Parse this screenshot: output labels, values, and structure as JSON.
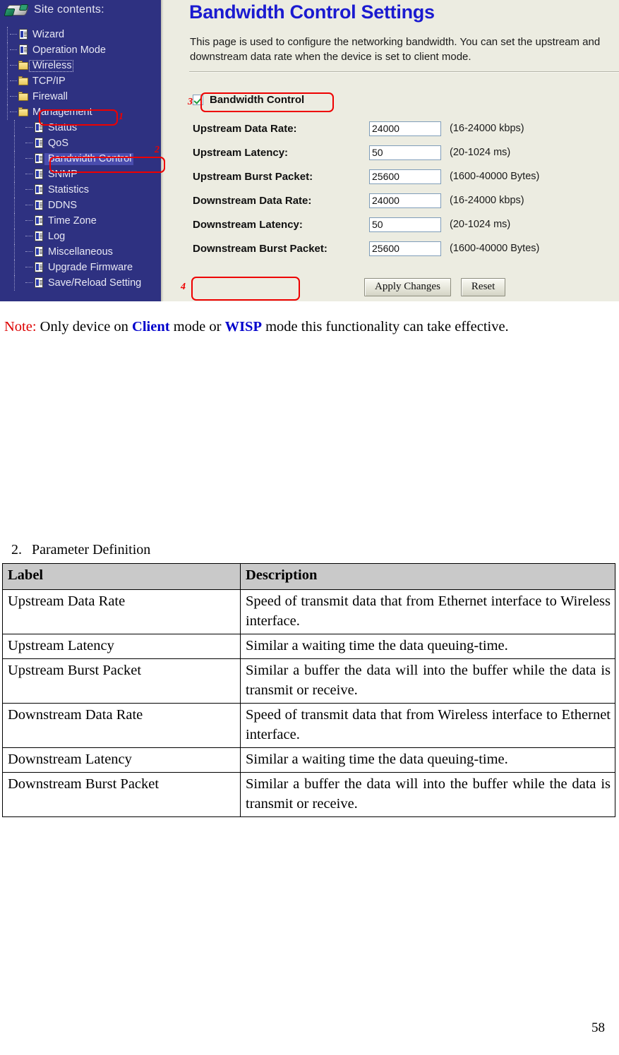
{
  "screenshot": {
    "sidebar": {
      "header_label": "Site contents:",
      "device_icon": "router-device-icon",
      "items": [
        {
          "label": "Wizard",
          "icon": "page-icon",
          "level": 1,
          "state": "normal"
        },
        {
          "label": "Operation Mode",
          "icon": "page-icon",
          "level": 1,
          "state": "normal"
        },
        {
          "label": "Wireless",
          "icon": "folder-icon",
          "level": 1,
          "state": "focused"
        },
        {
          "label": "TCP/IP",
          "icon": "folder-icon",
          "level": 1,
          "state": "normal"
        },
        {
          "label": "Firewall",
          "icon": "folder-icon",
          "level": 1,
          "state": "normal"
        },
        {
          "label": "Management",
          "icon": "folder-icon",
          "level": 1,
          "state": "annotated"
        },
        {
          "label": "Status",
          "icon": "page-icon",
          "level": 2,
          "state": "normal"
        },
        {
          "label": "QoS",
          "icon": "page-icon",
          "level": 2,
          "state": "normal"
        },
        {
          "label": "Bandwidth Control",
          "icon": "page-icon",
          "level": 2,
          "state": "selected"
        },
        {
          "label": "SNMP",
          "icon": "page-icon",
          "level": 2,
          "state": "normal"
        },
        {
          "label": "Statistics",
          "icon": "page-icon",
          "level": 2,
          "state": "normal"
        },
        {
          "label": "DDNS",
          "icon": "page-icon",
          "level": 2,
          "state": "normal"
        },
        {
          "label": "Time Zone",
          "icon": "page-icon",
          "level": 2,
          "state": "normal"
        },
        {
          "label": "Log",
          "icon": "page-icon",
          "level": 2,
          "state": "normal"
        },
        {
          "label": "Miscellaneous",
          "icon": "page-icon",
          "level": 2,
          "state": "normal"
        },
        {
          "label": "Upgrade Firmware",
          "icon": "page-icon",
          "level": 2,
          "state": "normal"
        },
        {
          "label": "Save/Reload Setting",
          "icon": "page-icon",
          "level": 2,
          "state": "normal"
        }
      ]
    },
    "content": {
      "title": "Bandwidth Control Settings",
      "description": "This page is used to configure the networking bandwidth. You can set the upstream and downstream data rate when the device is set to client mode.",
      "enable": {
        "label": "Bandwidth Control",
        "checked": true
      },
      "fields": [
        {
          "label": "Upstream Data Rate:",
          "value": "24000",
          "hint": "(16-24000 kbps)"
        },
        {
          "label": "Upstream Latency:",
          "value": "50",
          "hint": "(20-1024 ms)"
        },
        {
          "label": "Upstream Burst Packet:",
          "value": "25600",
          "hint": "(1600-40000 Bytes)"
        },
        {
          "label": "Downstream Data Rate:",
          "value": "24000",
          "hint": "(16-24000 kbps)"
        },
        {
          "label": "Downstream Latency:",
          "value": "50",
          "hint": "(20-1024 ms)"
        },
        {
          "label": "Downstream Burst Packet:",
          "value": "25600",
          "hint": "(1600-40000 Bytes)"
        }
      ],
      "buttons": {
        "apply": "Apply Changes",
        "reset": "Reset"
      }
    },
    "annotations": [
      {
        "number": "1",
        "target": "Management"
      },
      {
        "number": "2",
        "target": "Bandwidth Control"
      },
      {
        "number": "3",
        "target": "Bandwidth Control checkbox"
      },
      {
        "number": "4",
        "target": "Apply Changes"
      }
    ],
    "annotation_color": "#ee0000"
  },
  "note": {
    "prefix": "Note:",
    "part1": " Only device on ",
    "mode1": "Client",
    "part2": " mode or ",
    "mode2": "WISP",
    "part3": " mode this functionality can take effective."
  },
  "parameters_section": {
    "heading_number": "2.",
    "heading_text": "Parameter Definition",
    "columns": [
      "Label",
      "Description"
    ],
    "rows": [
      {
        "label": "Upstream Data Rate",
        "description": "Speed of transmit data that from Ethernet interface to Wireless interface."
      },
      {
        "label": "Upstream Latency",
        "description": "Similar a waiting time the data queuing-time."
      },
      {
        "label": "Upstream Burst Packet",
        "description": "Similar a buffer the data will into the buffer while the data is transmit or receive."
      },
      {
        "label": "Downstream Data Rate",
        "description": "Speed of transmit data that from Wireless interface to Ethernet interface."
      },
      {
        "label": "Downstream Latency",
        "description": "Similar a waiting time the data queuing-time."
      },
      {
        "label": "Downstream Burst Packet",
        "description": "Similar a buffer the data will into the buffer while the data is transmit or receive."
      }
    ]
  },
  "page_number": "58"
}
